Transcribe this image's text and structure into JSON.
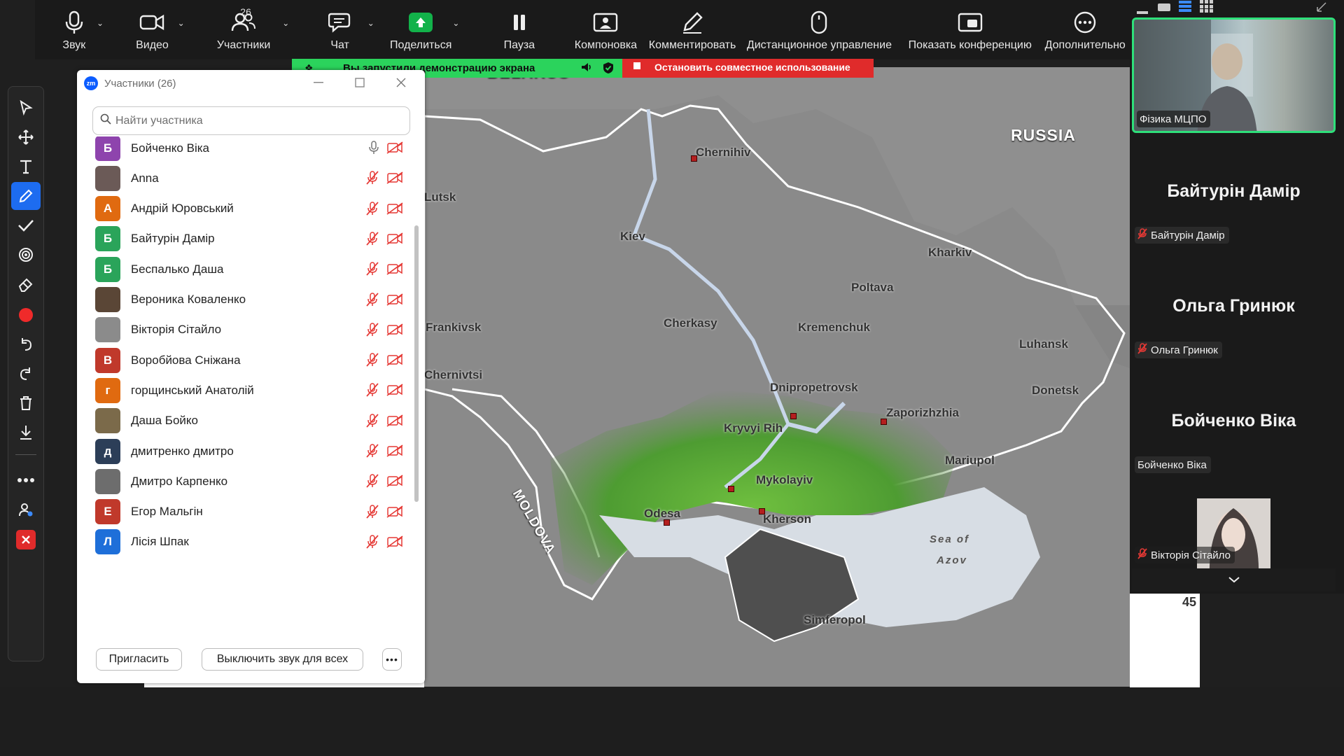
{
  "toolbar": {
    "items": [
      {
        "label": "Звук",
        "icon": "microphone-icon"
      },
      {
        "label": "Видео",
        "icon": "video-camera-icon"
      },
      {
        "label": "Участники",
        "icon": "participants-icon",
        "count": "26"
      },
      {
        "label": "Чат",
        "icon": "chat-icon"
      },
      {
        "label": "Поделиться",
        "icon": "share-screen-icon"
      },
      {
        "label": "Пауза",
        "icon": "pause-icon"
      },
      {
        "label": "Компоновка",
        "icon": "layout-icon"
      },
      {
        "label": "Комментировать",
        "icon": "annotate-pen-icon"
      },
      {
        "label": "Дистанционное управление",
        "icon": "mouse-icon"
      },
      {
        "label": "Показать конференцию",
        "icon": "show-meeting-icon"
      },
      {
        "label": "Дополнительно",
        "icon": "more-icon"
      }
    ]
  },
  "share_banner": {
    "status": "Вы запустили демонстрацию экрана",
    "stop": "Остановить совместное использование",
    "colors": {
      "status_bg": "#2bd35c",
      "stop_bg": "#e02b2b"
    }
  },
  "panel": {
    "title": "Участники (26)",
    "search_placeholder": "Найти участника",
    "participants": [
      {
        "name": "Бойченко Віка",
        "initial": "Б",
        "color": "#8e44ad",
        "mic": "on"
      },
      {
        "name": "Anna",
        "initial": "",
        "color": "#6b5a57",
        "mic": "muted"
      },
      {
        "name": "Андрій Юровський",
        "initial": "А",
        "color": "#e06a10",
        "mic": "muted"
      },
      {
        "name": "Байтурін Дамір",
        "initial": "Б",
        "color": "#2aa45a",
        "mic": "muted"
      },
      {
        "name": "Беспалько Даша",
        "initial": "Б",
        "color": "#2aa45a",
        "mic": "muted"
      },
      {
        "name": "Вероника Коваленко",
        "initial": "",
        "color": "#5a4636",
        "mic": "muted"
      },
      {
        "name": "Вікторія Сітайло",
        "initial": "",
        "color": "#8b8b8b",
        "mic": "muted"
      },
      {
        "name": "Воробйова Сніжана",
        "initial": "В",
        "color": "#c0392b",
        "mic": "muted"
      },
      {
        "name": "горщинський Анатолій",
        "initial": "г",
        "color": "#e06a10",
        "mic": "muted"
      },
      {
        "name": "Даша Бойко",
        "initial": "",
        "color": "#7b6a4a",
        "mic": "muted"
      },
      {
        "name": "дмитренко дмитро",
        "initial": "д",
        "color": "#2c3e58",
        "mic": "muted"
      },
      {
        "name": "Дмитро Карпенко",
        "initial": "",
        "color": "#6d6d6d",
        "mic": "muted"
      },
      {
        "name": "Егор Мальгін",
        "initial": "Е",
        "color": "#c0392b",
        "mic": "muted"
      },
      {
        "name": "Лісія Шпак",
        "initial": "Л",
        "color": "#1e6fd9",
        "mic": "muted"
      }
    ],
    "invite": "Пригласить",
    "mute_all": "Выключить звук для всех"
  },
  "map": {
    "countries": [
      "BELARUS",
      "RUSSIA",
      "MOLDOVA"
    ],
    "cities": [
      "Chernihiv",
      "Kiev",
      "Kharkiv",
      "Poltava",
      "Cherkasy",
      "Kremenchuk",
      "Frankivsk",
      "Lutsk",
      "Chernivtsi",
      "Dnipropetrovsk",
      "Zaporizhzhia",
      "Luhansk",
      "Donetsk",
      "Kryvyi Rih",
      "Mykolayiv",
      "Odesa",
      "Kherson",
      "Mariupol",
      "Simferopol"
    ],
    "seas": [
      "Sea of",
      "Azov"
    ],
    "strip_number": "45"
  },
  "videos": {
    "self_name": "Фізика МЦПО",
    "tiles": [
      {
        "display": "Байтурін Дамір",
        "tag": "Байтурін Дамір",
        "muted": true
      },
      {
        "display": "Ольга Гринюк",
        "tag": "Ольга Гринюк",
        "muted": true
      },
      {
        "display": "Бойченко Віка",
        "tag": "Бойченко Віка",
        "muted": false
      }
    ],
    "last_tag": "Вікторія Сітайло"
  }
}
